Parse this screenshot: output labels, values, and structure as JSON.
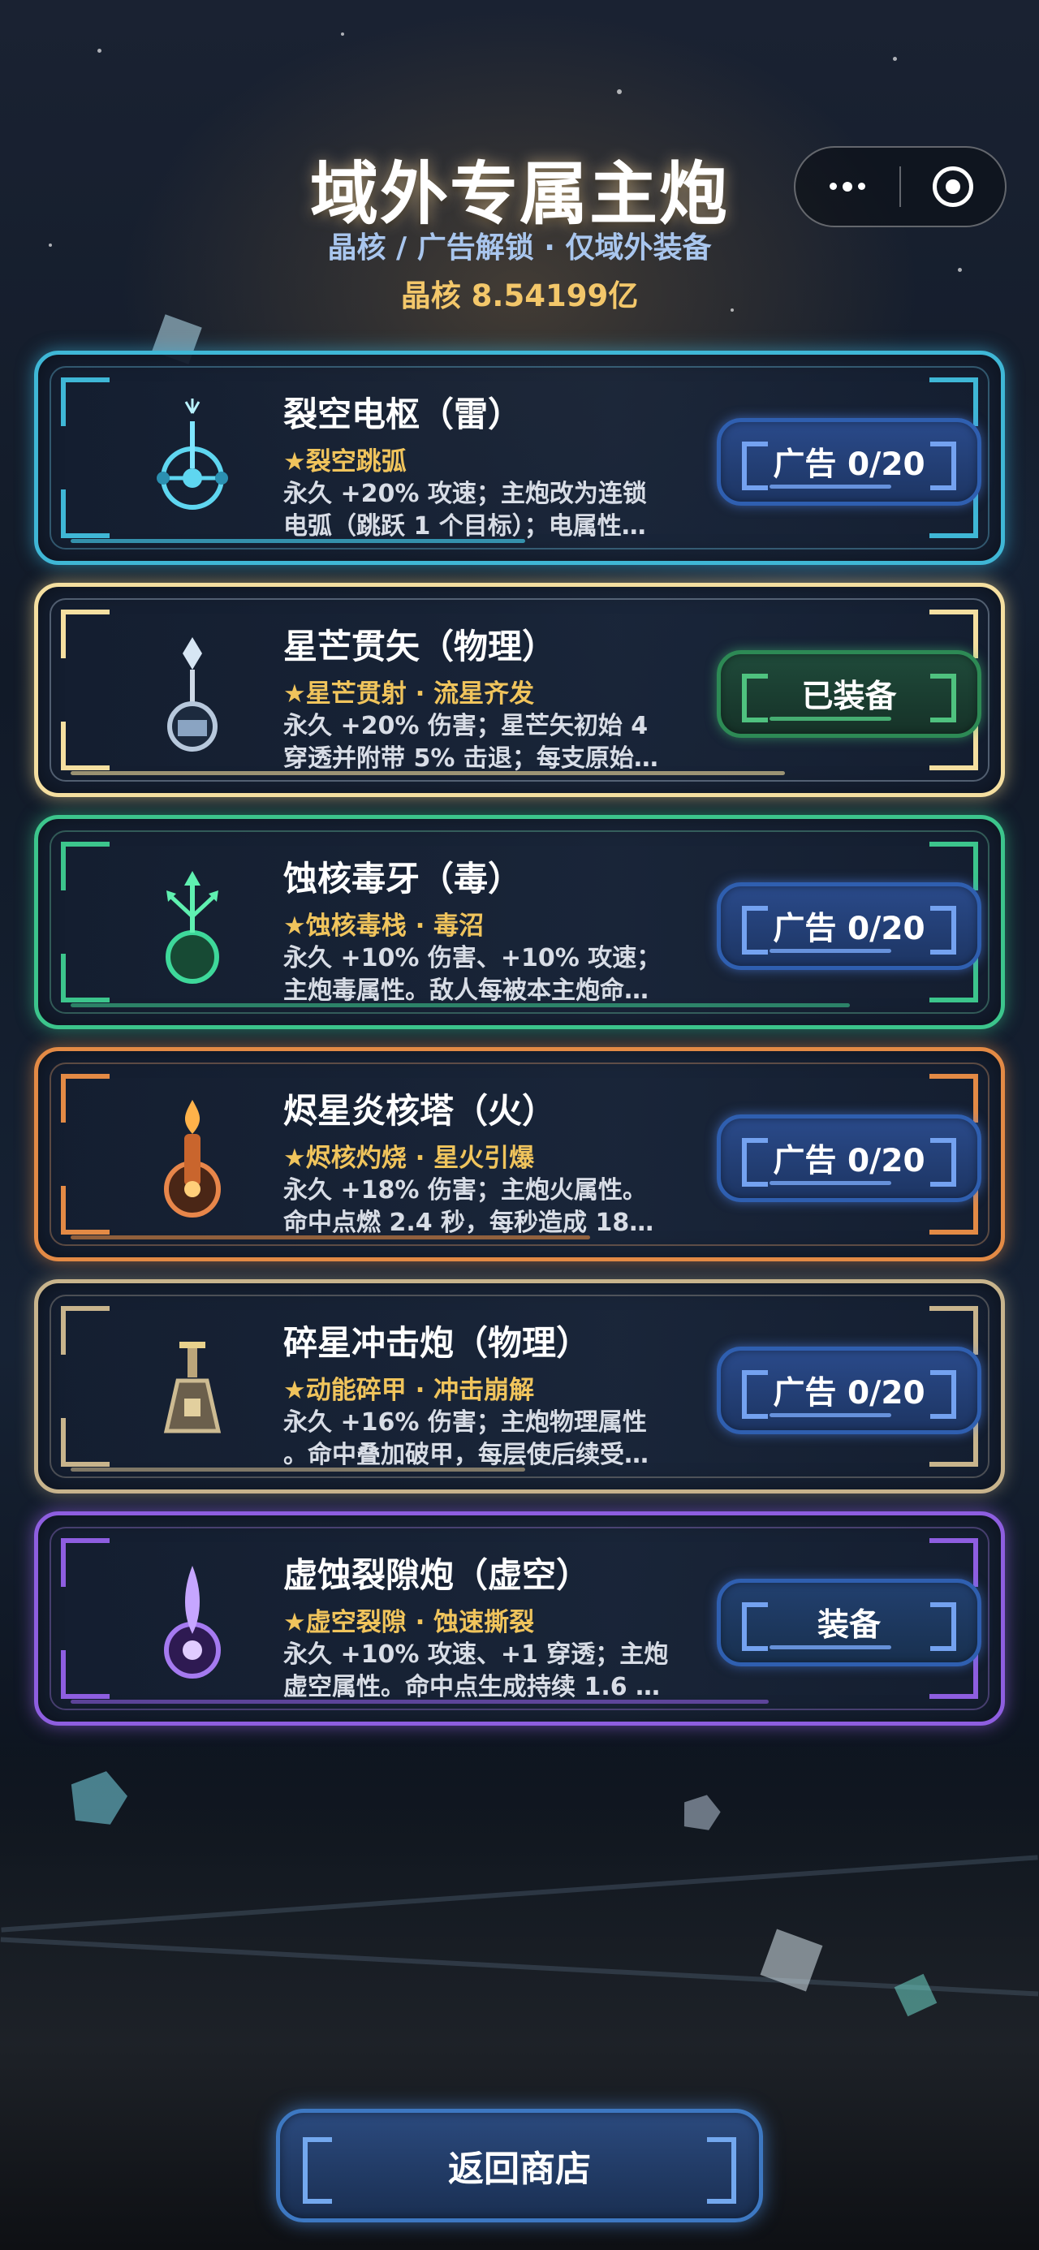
{
  "header": {
    "title": "域外专属主炮",
    "subtitle": "晶核 / 广告解锁 · 仅域外装备",
    "currency": "晶核 8.54199亿",
    "menu_icon": "more-dots-icon",
    "close_icon": "target-circle-icon"
  },
  "cards": [
    {
      "name": "裂空电枢（雷）",
      "tags": "★裂空跳弧",
      "desc1": "永久 +20% 攻速；主炮改为连锁",
      "desc2": "电弧（跳跃 1 个目标）；电属性…",
      "button": "广告 0/20",
      "icon": "lightning-turret-icon",
      "accent": "#3fb7d6"
    },
    {
      "name": "星芒贯矢（物理）",
      "tags": "★星芒贯射 · 流星齐发",
      "desc1": "永久 +20% 伤害；星芒矢初始 4",
      "desc2": "穿透并附带 5% 击退；每支原始…",
      "button": "已装备",
      "icon": "arrow-turret-icon",
      "accent": "#f5dfa0"
    },
    {
      "name": "蚀核毒牙（毒）",
      "tags": "★蚀核毒栈 · 毒沼",
      "desc1": "永久 +10% 伤害、+10% 攻速；",
      "desc2": "主炮毒属性。敌人每被本主炮命…",
      "button": "广告 0/20",
      "icon": "poison-turret-icon",
      "accent": "#3cc58c"
    },
    {
      "name": "烬星炎核塔（火）",
      "tags": "★烬核灼烧 · 星火引爆",
      "desc1": "永久 +18% 伤害；主炮火属性。",
      "desc2": "命中点燃 2.4 秒，每秒造成 18…",
      "button": "广告 0/20",
      "icon": "fire-turret-icon",
      "accent": "#e38a45"
    },
    {
      "name": "碎星冲击炮（物理）",
      "tags": "★动能碎甲 · 冲击崩解",
      "desc1": "永久 +16% 伤害；主炮物理属性",
      "desc2": "。命中叠加破甲，每层使后续受…",
      "button": "广告 0/20",
      "icon": "cannon-turret-icon",
      "accent": "#c8b48c"
    },
    {
      "name": "虚蚀裂隙炮（虚空）",
      "tags": "★虚空裂隙 · 蚀速撕裂",
      "desc1": "永久 +10% 攻速、+1 穿透；主炮",
      "desc2": "虚空属性。命中点生成持续 1.6 …",
      "button": "装备",
      "icon": "void-turret-icon",
      "accent": "#8e5ee0"
    }
  ],
  "footer": {
    "return_label": "返回商店"
  }
}
